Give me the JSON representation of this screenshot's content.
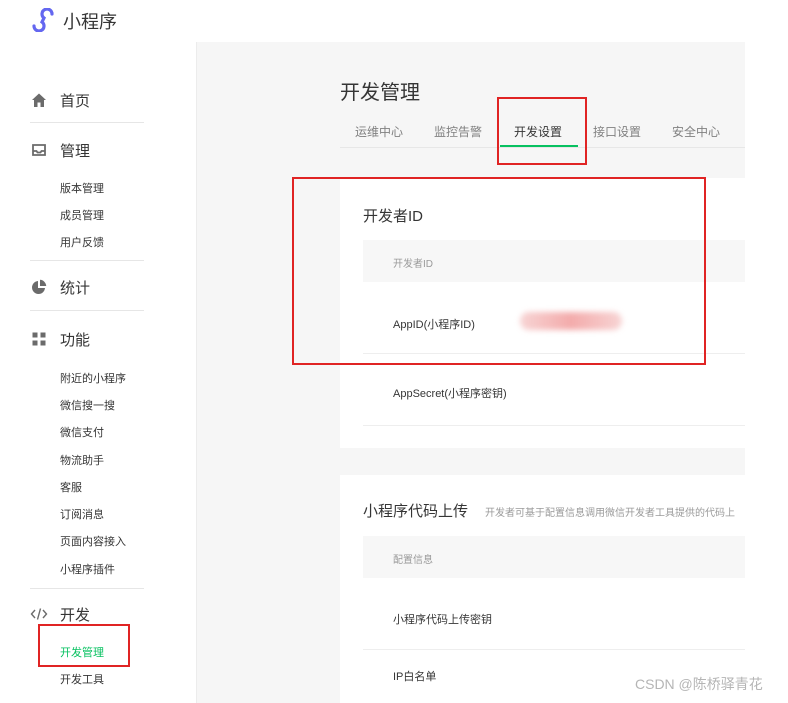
{
  "app": {
    "title": "小程序",
    "logo_icon": "miniprogram-logo-icon",
    "brand_color": "#6467f0"
  },
  "sidebar": {
    "groups": [
      {
        "label": "首页",
        "icon": "home-icon",
        "items": []
      },
      {
        "label": "管理",
        "icon": "inbox-icon",
        "items": [
          "版本管理",
          "成员管理",
          "用户反馈"
        ]
      },
      {
        "label": "统计",
        "icon": "pie-chart-icon",
        "items": []
      },
      {
        "label": "功能",
        "icon": "grid-icon",
        "items": [
          "附近的小程序",
          "微信搜一搜",
          "微信支付",
          "物流助手",
          "客服",
          "订阅消息",
          "页面内容接入",
          "小程序插件"
        ]
      },
      {
        "label": "开发",
        "icon": "code-icon",
        "items": [
          "开发管理",
          "开发工具"
        ]
      }
    ],
    "active_item": "开发管理",
    "accent_color": "#07c160"
  },
  "main": {
    "title": "开发管理",
    "tabs": [
      "运维中心",
      "监控告警",
      "开发设置",
      "接口设置",
      "安全中心"
    ],
    "active_tab": "开发设置",
    "developer_card": {
      "title": "开发者ID",
      "header": "开发者ID",
      "rows": [
        "AppID(小程序ID)",
        "AppSecret(小程序密钥)"
      ]
    },
    "upload_card": {
      "title": "小程序代码上传",
      "description": "开发者可基于配置信息调用微信开发者工具提供的代码上",
      "header": "配置信息",
      "rows": [
        "小程序代码上传密钥",
        "IP白名单"
      ]
    }
  },
  "highlight_color": "#e02424",
  "watermark": "CSDN @陈桥驿青花"
}
